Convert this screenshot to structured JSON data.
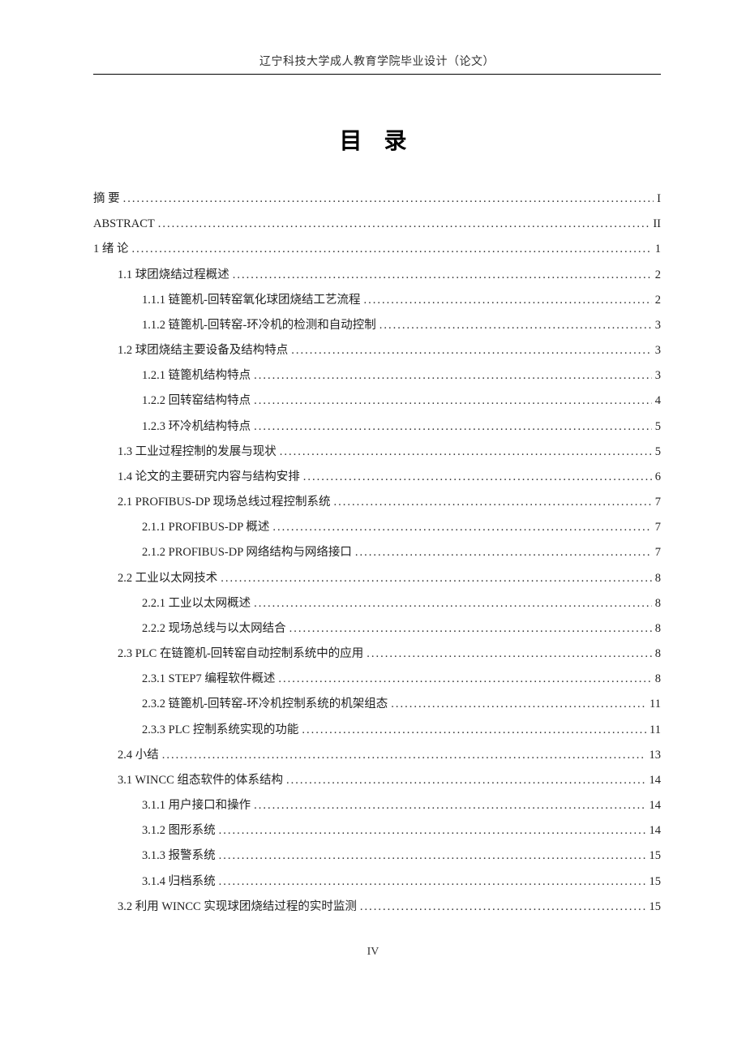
{
  "header": "辽宁科技大学成人教育学院毕业设计（论文）",
  "title": "目 录",
  "footer": "IV",
  "toc": [
    {
      "level": 0,
      "text": "摘 要",
      "page": "I"
    },
    {
      "level": 0,
      "text": "ABSTRACT",
      "page": "II"
    },
    {
      "level": 0,
      "text": "1 绪 论",
      "page": "1"
    },
    {
      "level": 1,
      "text": "1.1 球团烧结过程概述",
      "page": "2"
    },
    {
      "level": 2,
      "text": "1.1.1 链篦机-回转窑氧化球团烧结工艺流程",
      "page": "2"
    },
    {
      "level": 2,
      "text": "1.1.2 链篦机-回转窑-环冷机的检测和自动控制",
      "page": "3"
    },
    {
      "level": 1,
      "text": "1.2 球团烧结主要设备及结构特点",
      "page": "3"
    },
    {
      "level": 2,
      "text": "1.2.1 链篦机结构特点",
      "page": "3"
    },
    {
      "level": 2,
      "text": "1.2.2 回转窑结构特点",
      "page": "4"
    },
    {
      "level": 2,
      "text": "1.2.3 环冷机结构特点",
      "page": "5"
    },
    {
      "level": 1,
      "text": "1.3 工业过程控制的发展与现状",
      "page": "5"
    },
    {
      "level": 1,
      "text": "1.4 论文的主要研究内容与结构安排",
      "page": "6"
    },
    {
      "level": 1,
      "text": "2.1 PROFIBUS-DP 现场总线过程控制系统",
      "page": "7"
    },
    {
      "level": 2,
      "text": "2.1.1 PROFIBUS-DP 概述",
      "page": "7"
    },
    {
      "level": 2,
      "text": "2.1.2 PROFIBUS-DP 网络结构与网络接口",
      "page": "7"
    },
    {
      "level": 1,
      "text": "2.2 工业以太网技术",
      "page": "8"
    },
    {
      "level": 2,
      "text": "2.2.1 工业以太网概述",
      "page": "8"
    },
    {
      "level": 2,
      "text": "2.2.2 现场总线与以太网结合",
      "page": "8"
    },
    {
      "level": 1,
      "text": "2.3 PLC 在链篦机-回转窑自动控制系统中的应用",
      "page": "8"
    },
    {
      "level": 2,
      "text": "2.3.1 STEP7 编程软件概述",
      "page": "8"
    },
    {
      "level": 2,
      "text": "2.3.2 链篦机-回转窑-环冷机控制系统的机架组态",
      "page": "11"
    },
    {
      "level": 2,
      "text": "2.3.3 PLC 控制系统实现的功能",
      "page": "11"
    },
    {
      "level": 1,
      "text": "2.4 小结",
      "page": "13"
    },
    {
      "level": 1,
      "text": "3.1 WINCC 组态软件的体系结构",
      "page": "14"
    },
    {
      "level": 2,
      "text": "3.1.1 用户接口和操作",
      "page": "14"
    },
    {
      "level": 2,
      "text": "3.1.2 图形系统",
      "page": "14"
    },
    {
      "level": 2,
      "text": "3.1.3 报警系统",
      "page": "15"
    },
    {
      "level": 2,
      "text": "3.1.4 归档系统",
      "page": "15"
    },
    {
      "level": 1,
      "text": "3.2 利用 WINCC 实现球团烧结过程的实时监测",
      "page": "15"
    }
  ]
}
